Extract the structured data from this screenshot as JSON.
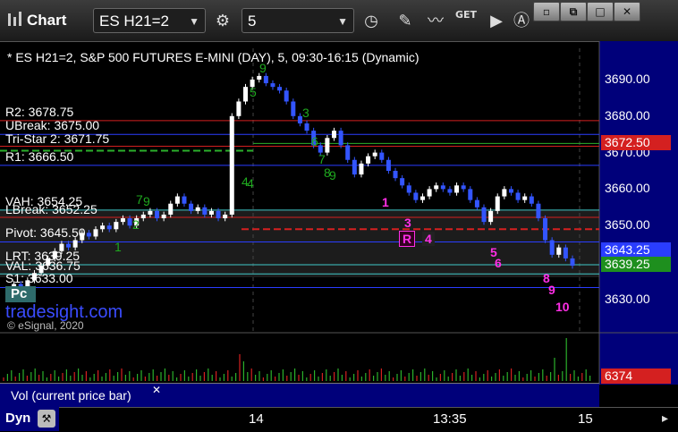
{
  "toolbar": {
    "logo_label": "Chart",
    "symbol": "ES H21=2",
    "interval": "5",
    "window_controls": [
      "min",
      "restore",
      "max",
      "close"
    ]
  },
  "chart": {
    "title": "* ES H21=2, S&P 500 FUTURES E-MINI (DAY), 5, 09:30-16:15 (Dynamic)",
    "watermark": "tradesight.com",
    "copyright": "© eSignal, 2020",
    "level_labels": {
      "r2": "R2: 3678.75",
      "ubreak": "UBreak: 3675.00",
      "tristar": "Tri-Star 2: 3671.75",
      "r1": "R1: 3666.50",
      "vah": "VAH: 3654.25",
      "lbreak": "LBreak: 3652.25",
      "pivot": "Pivot: 3645.50",
      "lrt": "LRT: 3639.25",
      "val": "VAL: 3636.75",
      "s1": "S1: 3633.00",
      "pc": "Pc"
    },
    "price_axis": [
      "3690.00",
      "3680.00",
      "3670.00",
      "3660.00",
      "3650.00",
      "3630.00"
    ],
    "price_tags": {
      "last": "3672.50",
      "blue": "3643.25",
      "green": "3639.25",
      "volume": "6374"
    },
    "time_axis": [
      "14",
      "13:35",
      "15"
    ],
    "volume_panel_label": "Vol (current price bar)",
    "dyn_label": "Dyn",
    "counters_magenta": [
      "1",
      "3",
      "4",
      "5",
      "6",
      "8",
      "9",
      "10",
      "R"
    ],
    "counters_green": [
      "9",
      "5",
      "3",
      "6",
      "7",
      "8",
      "9",
      "4",
      "7",
      "9",
      "1",
      "2",
      "4"
    ],
    "colors": {
      "bull_candle": "#ffffff",
      "bear_candle": "#3355ff",
      "red_level": "#d42020",
      "blue_level": "#2a3dff",
      "green_level": "#2bb02b",
      "cyan_level": "#40c8c8",
      "price_axis_bg": "#00007a",
      "magenta": "#ff2ee6"
    }
  }
}
